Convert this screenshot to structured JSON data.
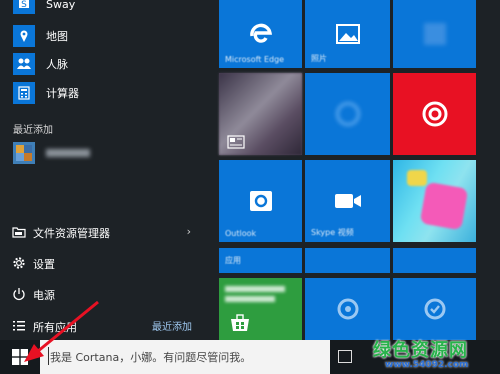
{
  "left_pane": {
    "apps": [
      {
        "label": "Sway",
        "color": "#0a76d8",
        "icon": "sway-icon"
      },
      {
        "label": "地图",
        "color": "#0a76d8",
        "icon": "maps-icon"
      },
      {
        "label": "人脉",
        "color": "#0a76d8",
        "icon": "people-icon"
      },
      {
        "label": "计算器",
        "color": "#0a76d8",
        "icon": "calculator-icon"
      }
    ],
    "recent_header": "最近添加",
    "system": [
      {
        "label": "文件资源管理器",
        "icon": "folder-icon",
        "has_submenu": true
      },
      {
        "label": "设置",
        "icon": "gear-icon"
      },
      {
        "label": "电源",
        "icon": "power-icon"
      },
      {
        "label": "所有应用",
        "icon": "list-icon"
      }
    ],
    "recent_link": "最近添加"
  },
  "tiles": [
    {
      "name": "edge",
      "color": "#0a76d8",
      "icon": "edge-icon"
    },
    {
      "name": "photos",
      "color": "#0a76d8",
      "icon": "photos-icon"
    },
    {
      "name": "tile-r1c3",
      "color": "#0a76d8",
      "icon": "tile-icon"
    },
    {
      "name": "news",
      "color": "#4d4256",
      "icon": "news-icon"
    },
    {
      "name": "tile-r2c2",
      "color": "#0a76d8",
      "icon": "tile-icon"
    },
    {
      "name": "music",
      "color": "#e81123",
      "icon": "music-icon"
    },
    {
      "name": "outlook",
      "color": "#0a76d8",
      "icon": "outlook-icon"
    },
    {
      "name": "skype-video",
      "color": "#0a76d8",
      "icon": "video-icon"
    },
    {
      "name": "candy",
      "color": "#38c8e8",
      "icon": "game-icon"
    },
    {
      "name": "tile-r4c1",
      "color": "#0a76d8",
      "icon": "tile-icon"
    },
    {
      "name": "tile-r4c2",
      "color": "#0a76d8",
      "icon": "tile-icon"
    },
    {
      "name": "tile-r4c3",
      "color": "#0a76d8",
      "icon": "tile-icon"
    },
    {
      "name": "store",
      "color": "#2e9d3f",
      "icon": "store-icon"
    },
    {
      "name": "tile-r5c2",
      "color": "#0a76d8",
      "icon": "tile-icon"
    },
    {
      "name": "tile-r5c3",
      "color": "#0a76d8",
      "icon": "tile-icon"
    }
  ],
  "taskbar": {
    "search_placeholder": "我是 Cortana，小娜。有问题尽管问我。"
  },
  "watermark": {
    "title": "绿色资源网",
    "url": "www.54092.com"
  },
  "colors": {
    "accent": "#0a76d8",
    "start_bg": "#1d2226",
    "arrow": "#e81123"
  }
}
